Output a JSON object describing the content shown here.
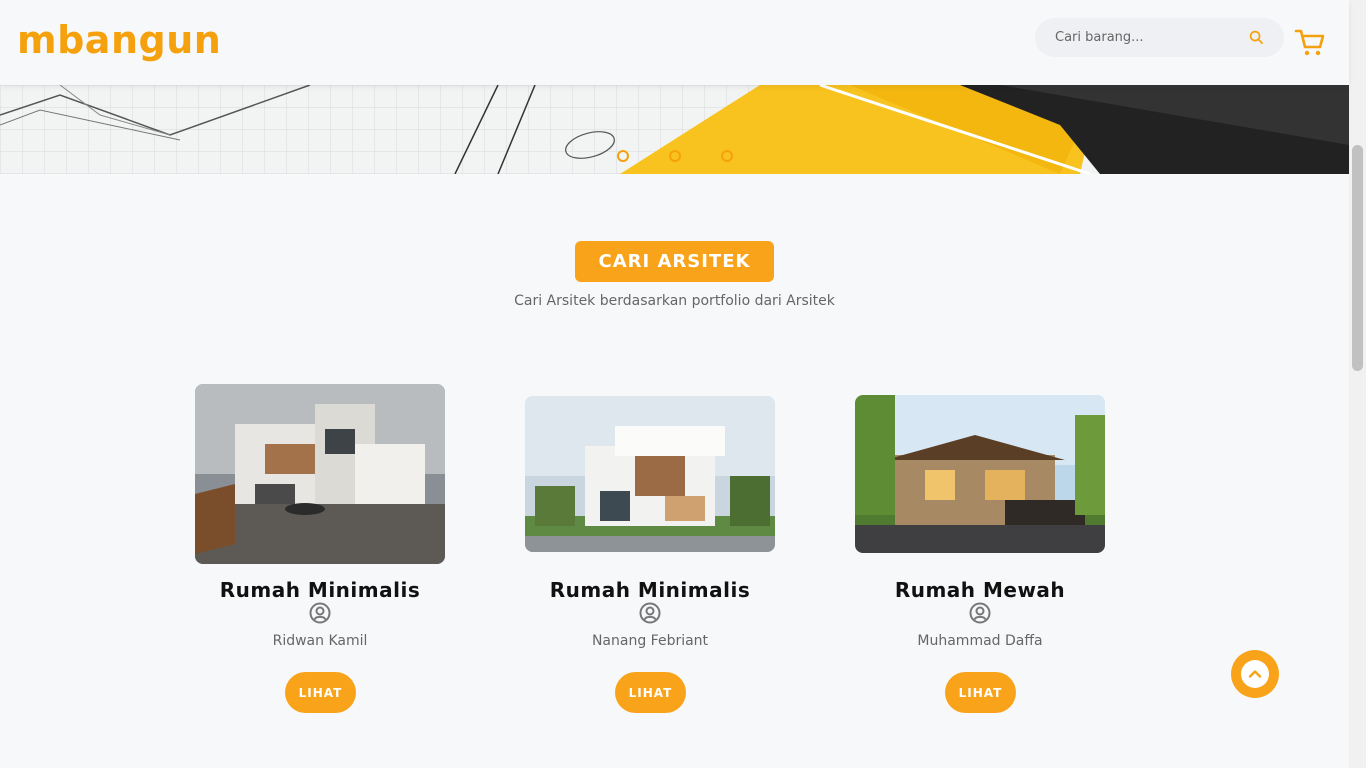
{
  "brand": {
    "logo_text": "mbangun",
    "accent": "#f5a10d"
  },
  "header": {
    "search": {
      "placeholder": "Cari barang...",
      "icon": "search-icon"
    },
    "cart_icon": "cart-icon"
  },
  "hero": {
    "slides": 3
  },
  "section": {
    "title": "CARI ARSITEK",
    "subtitle": "Cari Arsitek berdasarkan portfolio dari Arsitek"
  },
  "cards": [
    {
      "title": "Rumah Minimalis",
      "author": "Ridwan Kamil",
      "button": "LIHAT"
    },
    {
      "title": "Rumah Minimalis",
      "author": "Nanang Febriant",
      "button": "LIHAT"
    },
    {
      "title": "Rumah Mewah",
      "author": "Muhammad Daffa",
      "button": "LIHAT"
    }
  ],
  "scroll_top_icon": "chevron-up-icon"
}
